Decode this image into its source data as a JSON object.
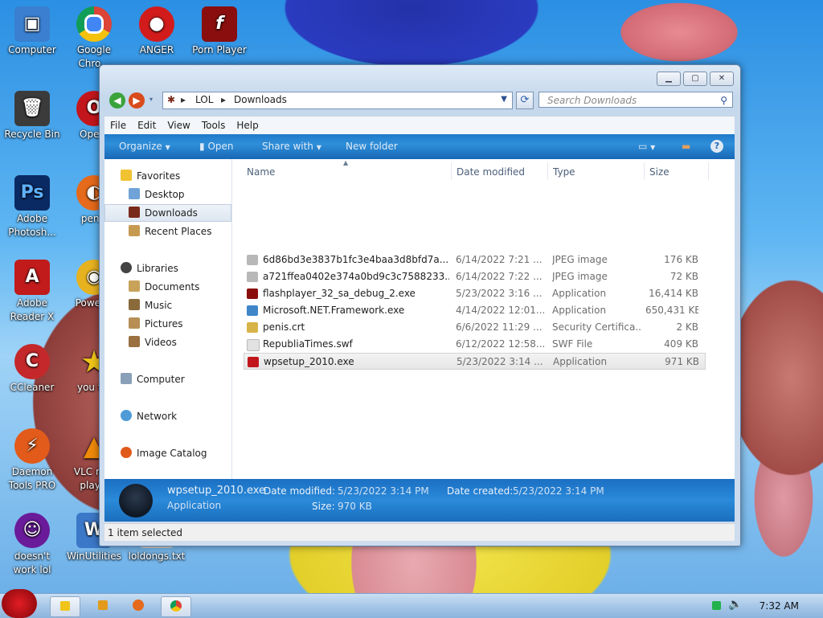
{
  "desktop": {
    "icons": [
      {
        "label": "Computer",
        "icon": "computer-icon",
        "color": "#3a7fd0"
      },
      {
        "label": "Google Chro...",
        "icon": "chrome-icon",
        "color": "#2f9e44"
      },
      {
        "label": "ANGER",
        "icon": "angry-bird-icon",
        "color": "#d21c1c"
      },
      {
        "label": "Porn Player",
        "icon": "flash-icon",
        "color": "#8a0e0e"
      },
      {
        "label": "Recycle Bin",
        "icon": "recycle-bin-icon",
        "color": "#3b3b3b"
      },
      {
        "label": "Ope...",
        "icon": "opera-icon",
        "color": "#c3161c"
      },
      {
        "label": "Adobe Photosh...",
        "icon": "photoshop-icon",
        "color": "#0a2a63"
      },
      {
        "label": "penis",
        "icon": "firefox-icon",
        "color": "#e56a1b"
      },
      {
        "label": "Adobe Reader X",
        "icon": "adobe-reader-icon",
        "color": "#c11b1b"
      },
      {
        "label": "Power...",
        "icon": "dvd-icon",
        "color": "#e7b21f"
      },
      {
        "label": "CCleaner",
        "icon": "ccleaner-icon",
        "color": "#c4282b"
      },
      {
        "label": "you t...",
        "icon": "star-icon",
        "color": "#f0c419"
      },
      {
        "label": "Daemon Tools PRO",
        "icon": "daemon-tools-icon",
        "color": "#e25b1a"
      },
      {
        "label": "VLC m... play...",
        "icon": "vlc-icon",
        "color": "#f08a0a"
      },
      {
        "label": "doesn't work lol",
        "icon": "yahoo-messenger-icon",
        "color": "#6a1b9a"
      },
      {
        "label": "WinUtilities",
        "icon": "winutilities-icon",
        "color": "#3c78c8"
      },
      {
        "label": "loldongs.txt",
        "icon": "text-file-icon",
        "color": "#d0d0d0"
      }
    ]
  },
  "window": {
    "caption_buttons": [
      "▭",
      "⧉",
      "✕"
    ],
    "breadcrumb": [
      "LOL",
      "Downloads"
    ],
    "search_placeholder": "Search Downloads",
    "menu": [
      "File",
      "Edit",
      "View",
      "Tools",
      "Help"
    ],
    "toolbar": {
      "organize": "Organize",
      "open": "Open",
      "share_with": "Share with",
      "new_folder": "New folder"
    },
    "nav": {
      "favorites": "Favorites",
      "desktop": "Desktop",
      "downloads": "Downloads",
      "recent_places": "Recent Places",
      "libraries": "Libraries",
      "documents": "Documents",
      "music": "Music",
      "pictures": "Pictures",
      "videos": "Videos",
      "computer": "Computer",
      "network": "Network",
      "image_catalog": "Image Catalog"
    },
    "columns": {
      "name": "Name",
      "date": "Date modified",
      "type": "Type",
      "size": "Size"
    },
    "files": [
      {
        "name": "6d86bd3e3837b1fc3e4baa3d8bfd7a...",
        "date": "6/14/2022 7:21 ...",
        "type": "JPEG image",
        "size": "176 KB",
        "icon_color": "#b8b8b8"
      },
      {
        "name": "a721ffea0402e374a0bd9c3c7588233...",
        "date": "6/14/2022 7:22 ...",
        "type": "JPEG image",
        "size": "72 KB",
        "icon_color": "#b8b8b8"
      },
      {
        "name": "flashplayer_32_sa_debug_2.exe",
        "date": "5/23/2022 3:16 ...",
        "type": "Application",
        "size": "16,414 KB",
        "icon_color": "#8a0e0e"
      },
      {
        "name": "Microsoft.NET.Framework.exe",
        "date": "4/14/2022 12:01...",
        "type": "Application",
        "size": "650,431 KB",
        "icon_color": "#3f86c9"
      },
      {
        "name": "penis.crt",
        "date": "6/6/2022 11:29 ...",
        "type": "Security Certifica...",
        "size": "2 KB",
        "icon_color": "#d7b447"
      },
      {
        "name": "RepubliaTimes.swf",
        "date": "6/12/2022 12:58...",
        "type": "SWF File",
        "size": "409 KB",
        "icon_color": "#e2e2e2"
      },
      {
        "name": "wpsetup_2010.exe",
        "date": "5/23/2022 3:14 ...",
        "type": "Application",
        "size": "971 KB",
        "icon_color": "#c0161c"
      }
    ],
    "details": {
      "filename": "wpsetup_2010.exe",
      "type": "Application",
      "date_modified_label": "Date modified:",
      "date_modified": "5/23/2022 3:14 PM",
      "date_created_label": "Date created:",
      "date_created": "5/23/2022 3:14 PM",
      "size_label": "Size:",
      "size": "970 KB"
    },
    "status": "1 item selected"
  },
  "taskbar": {
    "clock": "7:32 AM"
  }
}
